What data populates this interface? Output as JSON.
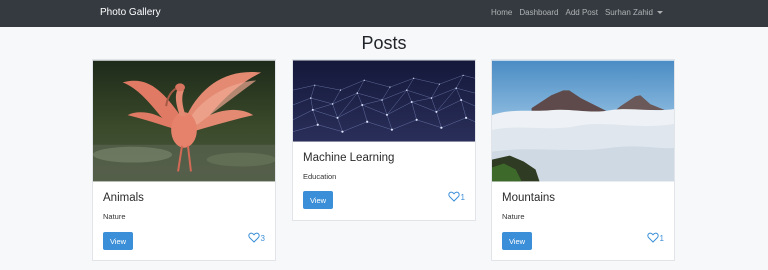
{
  "navbar": {
    "brand": "Photo Gallery",
    "links": [
      "Home",
      "Dashboard",
      "Add Post",
      "Surhan Zahid"
    ]
  },
  "page": {
    "title": "Posts"
  },
  "posts": [
    {
      "title": "Animals",
      "category": "Nature",
      "button": "View",
      "likes": "3",
      "image": "bird-icon"
    },
    {
      "title": "Machine Learning",
      "category": "Education",
      "button": "View",
      "likes": "1",
      "image": "network-icon"
    },
    {
      "title": "Mountains",
      "category": "Nature",
      "button": "View",
      "likes": "1",
      "image": "mountain-icon"
    }
  ],
  "colors": {
    "navbar": "#343a40",
    "accent": "#3b8fd8",
    "background": "#f7f8fa"
  }
}
